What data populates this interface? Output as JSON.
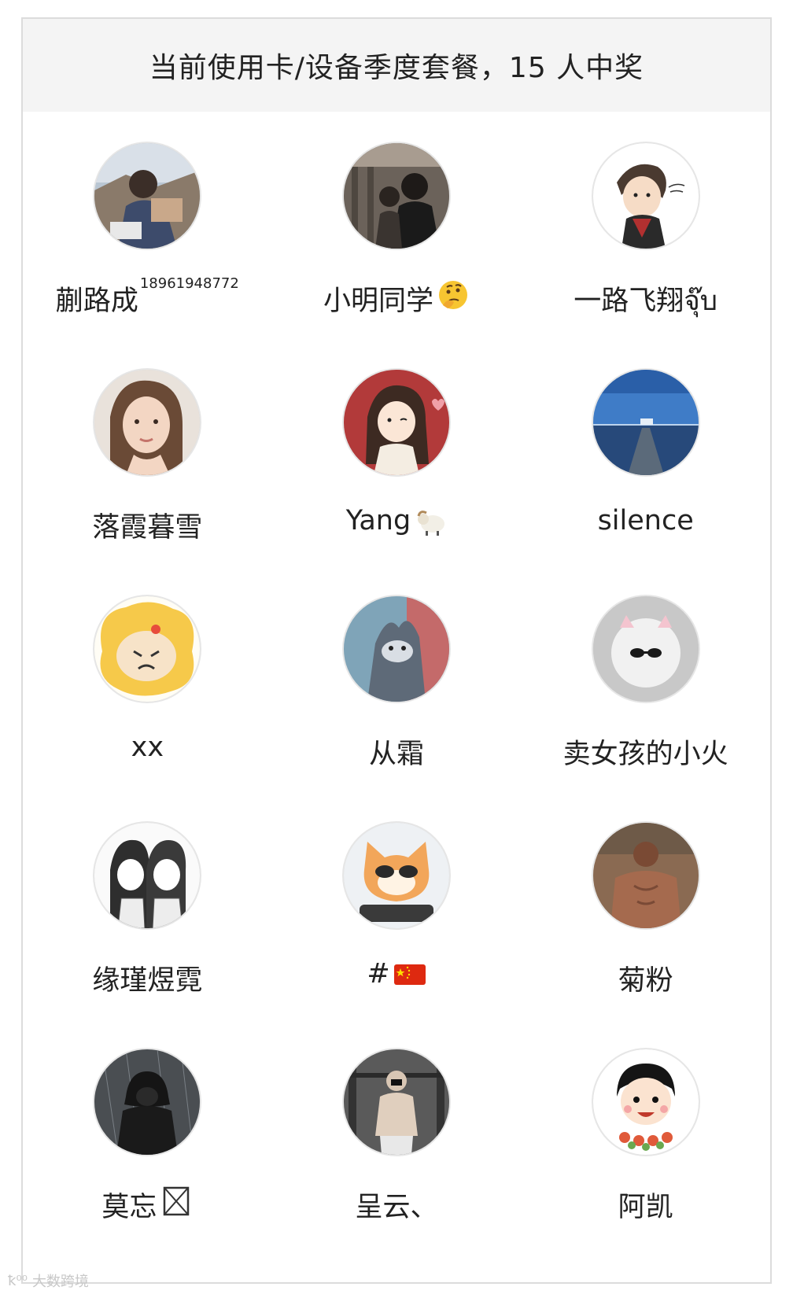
{
  "header": {
    "title": "当前使用卡/设备季度套餐，15 人中奖"
  },
  "winners": [
    {
      "name": "蒯路成",
      "sup": "18961948772",
      "emoji": "",
      "avatar": "photo-man-outdoor"
    },
    {
      "name": "小明同学",
      "sup": "",
      "emoji": "thinking-face",
      "avatar": "photo-couple"
    },
    {
      "name": "一路飞翔จุ๊บ",
      "sup": "",
      "emoji": "",
      "avatar": "cartoon-boy-scarf"
    },
    {
      "name": "落霞暮雪",
      "sup": "",
      "emoji": "",
      "avatar": "photo-woman"
    },
    {
      "name": "Yang",
      "sup": "",
      "emoji": "sheep",
      "avatar": "cartoon-girl-heart"
    },
    {
      "name": "silence",
      "sup": "",
      "emoji": "",
      "avatar": "photo-ocean"
    },
    {
      "name": "xx",
      "sup": "",
      "emoji": "",
      "avatar": "cartoon-bear-yellow"
    },
    {
      "name": "从霜",
      "sup": "",
      "emoji": "",
      "avatar": "cartoon-cat-tom"
    },
    {
      "name": "卖女孩的小火",
      "sup": "",
      "emoji": "",
      "avatar": "fluffy-cat-sunglasses"
    },
    {
      "name": "缘瑾煜霓",
      "sup": "",
      "emoji": "",
      "avatar": "sketch-two-girls"
    },
    {
      "name": "#",
      "sup": "",
      "emoji": "china-flag",
      "avatar": "cartoon-cat-sunglasses"
    },
    {
      "name": "菊粉",
      "sup": "",
      "emoji": "",
      "avatar": "photo-shirtless-man"
    },
    {
      "name": "莫忘",
      "sup": "",
      "emoji": "missing-glyph",
      "avatar": "photo-hooded-rain"
    },
    {
      "name": "呈云、",
      "sup": "",
      "emoji": "",
      "avatar": "photo-gym-man"
    },
    {
      "name": "阿凯",
      "sup": "",
      "emoji": "",
      "avatar": "cartoon-boy-flowers"
    }
  ],
  "watermark": {
    "text": "大数跨境"
  },
  "colors": {
    "header_bg": "#f4f4f4",
    "border": "#dcdcdc",
    "text": "#222222"
  }
}
